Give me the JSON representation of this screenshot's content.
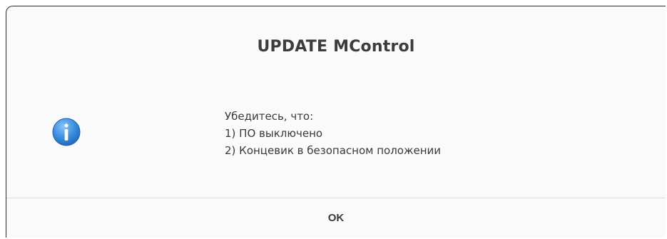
{
  "dialog": {
    "title": "UPDATE MControl",
    "icon": "info-icon",
    "message_lines": [
      "Убедитесь, что:",
      "1) ПО выключено",
      "2) Концевик в безопасном положении"
    ],
    "ok_label": "OK"
  },
  "colors": {
    "dialog_background": "#fafafa",
    "icon_blue": "#2a7fd4",
    "text": "#3a3a3a",
    "separator": "#dcdcdc"
  }
}
